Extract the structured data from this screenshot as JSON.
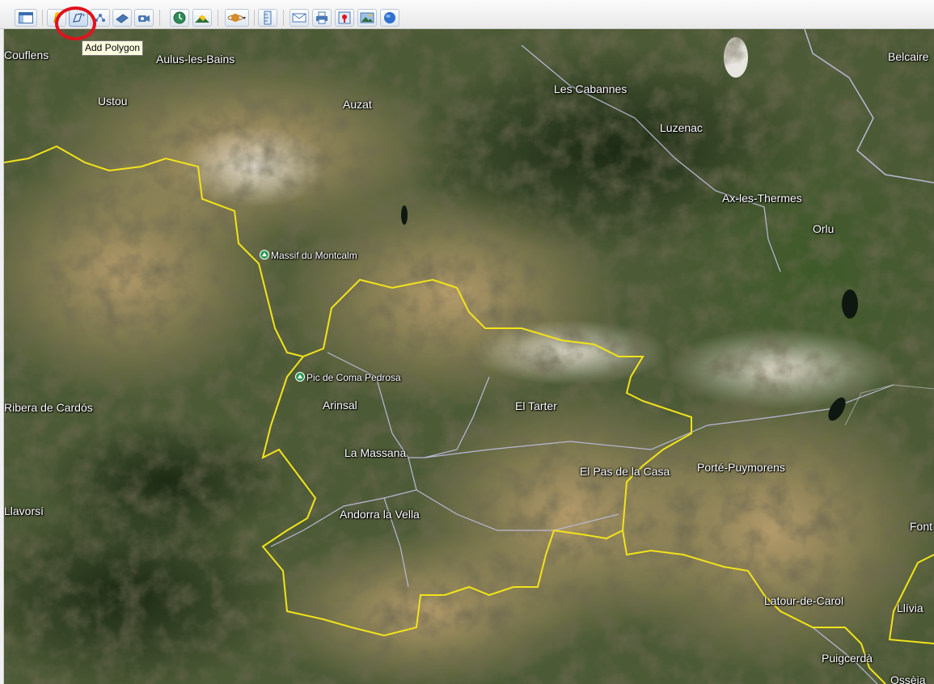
{
  "toolbar": {
    "buttons": [
      {
        "name": "sidebar-toggle-button",
        "icon": "sidebar-icon"
      },
      {
        "name": "add-placemark-button",
        "icon": "placemark-pin-icon"
      },
      {
        "name": "add-polygon-button",
        "icon": "polygon-icon"
      },
      {
        "name": "add-path-button",
        "icon": "path-icon"
      },
      {
        "name": "add-image-overlay-button",
        "icon": "image-overlay-icon"
      },
      {
        "name": "record-tour-button",
        "icon": "record-tour-icon"
      },
      {
        "name": "historical-imagery-button",
        "icon": "historical-clock-icon"
      },
      {
        "name": "sunlight-button",
        "icon": "sunlight-icon"
      },
      {
        "name": "switch-planet-button",
        "icon": "planet-icon"
      },
      {
        "name": "ruler-button",
        "icon": "ruler-icon"
      },
      {
        "name": "email-button",
        "icon": "email-icon"
      },
      {
        "name": "print-button",
        "icon": "print-icon"
      },
      {
        "name": "view-in-maps-button",
        "icon": "maps-icon"
      },
      {
        "name": "save-image-button",
        "icon": "save-image-icon"
      },
      {
        "name": "earth-gallery-button",
        "icon": "globe-icon"
      }
    ],
    "tooltip": "Add Polygon"
  },
  "map": {
    "places": [
      {
        "name": "Couflens"
      },
      {
        "name": "Aulus-les-Bains"
      },
      {
        "name": "Ustou"
      },
      {
        "name": "Auzat"
      },
      {
        "name": "Les Cabannes"
      },
      {
        "name": "Luzenac"
      },
      {
        "name": "Belcaire"
      },
      {
        "name": "Ax-les-Thermes"
      },
      {
        "name": "Orlu"
      },
      {
        "name": "Massif du Montcalm"
      },
      {
        "name": "Pic de Coma Pedrosa"
      },
      {
        "name": "Arinsal"
      },
      {
        "name": "El Tarter"
      },
      {
        "name": "La Massana"
      },
      {
        "name": "El Pas de la Casa"
      },
      {
        "name": "Porté-Puymorens"
      },
      {
        "name": "Ribera de Cardós"
      },
      {
        "name": "Llavorsí"
      },
      {
        "name": "Andorra la Vella"
      },
      {
        "name": "Font"
      },
      {
        "name": "Latour-de-Carol"
      },
      {
        "name": "Llívia"
      },
      {
        "name": "Puigcerdà"
      },
      {
        "name": "Ossèja"
      }
    ],
    "colors": {
      "border": "#f2e31a",
      "road": "#b9b9d6",
      "terrain_dark": "#2c3a22",
      "terrain_light": "#9a8055"
    }
  }
}
